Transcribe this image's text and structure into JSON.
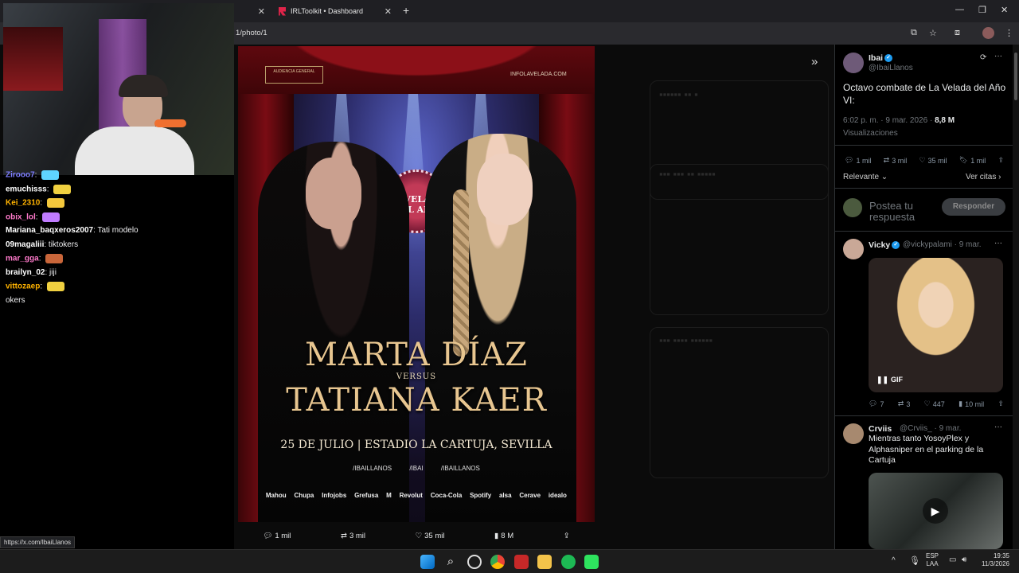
{
  "browser": {
    "tabs": [
      {
        "label": ""
      },
      {
        "label": "IRLToolkit • Dashboard"
      }
    ],
    "url": "1/photo/1",
    "status_url": "https://x.com/IbaiLlanos"
  },
  "poster": {
    "top_left": "AUDIENCIA GENERAL",
    "website": "INFOLAVELADA.COM",
    "badge": "LA VELADA DEL AÑO",
    "name1": "MARTA DÍAZ",
    "versus": "VERSUS",
    "name2": "TATIANA KAER",
    "date_venue": "25 DE JULIO | ESTADIO LA CARTUJA, SEVILLA",
    "socials": [
      "/IBAILLANOS",
      "/IBAI",
      "/IBAILLANOS"
    ],
    "sponsors": [
      "Mahou",
      "Chupa",
      "Infojobs",
      "Grefusa",
      "M",
      "Revolut",
      "Coca-Cola",
      "Spotify",
      "alsa",
      "Cerave",
      "idealo"
    ]
  },
  "viewer_actions": {
    "replies": "1 mil",
    "reposts": "3 mil",
    "likes": "35 mil",
    "views": "8 M"
  },
  "tweet": {
    "name": "Ibai",
    "handle": "@IbaiLlanos",
    "text": "Octavo combate de La Velada del Año VI:",
    "time": "6:02 p. m. · 9 mar. 2026 ·",
    "views_count": "8,8 M",
    "views_label": "Visualizaciones",
    "replies": "1 mil",
    "reposts": "3 mil",
    "likes": "35 mil",
    "bookmarks": "1 mil",
    "sort_label": "Relevante",
    "quotes_link": "Ver citas",
    "reply_placeholder": "Postea tu respuesta",
    "reply_button": "Responder"
  },
  "replies": [
    {
      "name": "Vicky",
      "handle": "@vickypalami · 9 mar.",
      "media_badge": "GIF",
      "replies": "7",
      "reposts": "3",
      "likes": "447",
      "views": "10 mil"
    },
    {
      "name": "Crviis",
      "handle": "@Crviis_ · 9 mar.",
      "text": "Mientras tanto YosoyPlex y Alphasniper en el parking de la Cartuja"
    }
  ],
  "chat": [
    {
      "user": "Zirooo7",
      "msg": "",
      "color": "#7d7dff"
    },
    {
      "user": "emuchisss",
      "msg": "",
      "color": "#ffffff"
    },
    {
      "user": "Kei_2310",
      "msg": "",
      "color": "#ffb300"
    },
    {
      "user": "obix_lol",
      "msg": "",
      "color": "#ff7acb"
    },
    {
      "user": "Mariana_baqxeros2007",
      "msg": "Tati modelo",
      "color": "#ffffff"
    },
    {
      "user": "09magaliii",
      "msg": "tiktokers",
      "color": "#ffffff"
    },
    {
      "user": "mar_gga",
      "msg": "",
      "color": "#ff7acb"
    },
    {
      "user": "brailyn_02",
      "msg": "jiji",
      "color": "#ffffff"
    },
    {
      "user": "vittozaep",
      "msg": "",
      "color": "#ffb300"
    },
    {
      "user": "",
      "msg": "okers",
      "color": "#ffffff"
    }
  ],
  "taskbar": {
    "lang1": "ESP",
    "lang2": "LAA",
    "time": "19:35",
    "date": "11/3/2026"
  }
}
